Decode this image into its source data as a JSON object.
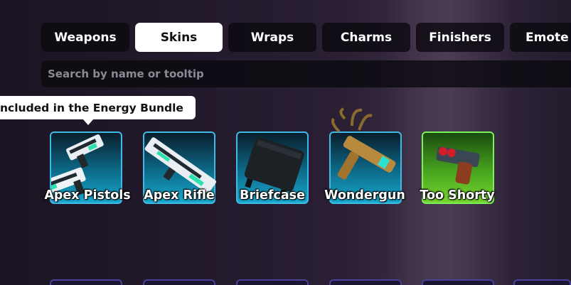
{
  "tabs": [
    {
      "label": "Weapons",
      "active": false
    },
    {
      "label": "Skins",
      "active": true
    },
    {
      "label": "Wraps",
      "active": false
    },
    {
      "label": "Charms",
      "active": false
    },
    {
      "label": "Finishers",
      "active": false
    },
    {
      "label": "Emote",
      "active": false
    }
  ],
  "search": {
    "placeholder": "Search by name or tooltip",
    "value": ""
  },
  "tooltip": {
    "text": "ncluded in the Energy Bundle"
  },
  "items": [
    {
      "name": "Apex Pistols",
      "rarity_color": "#3fb9e6",
      "icon": "apex-pistols-icon"
    },
    {
      "name": "Apex Rifle",
      "rarity_color": "#3fb9e6",
      "icon": "apex-rifle-icon"
    },
    {
      "name": "Briefcase",
      "rarity_color": "#3fb9e6",
      "icon": "briefcase-icon"
    },
    {
      "name": "Wondergun",
      "rarity_color": "#3fb9e6",
      "icon": "wondergun-icon"
    },
    {
      "name": "Too Shorty",
      "rarity_color": "#7bf255",
      "icon": "too-shorty-icon"
    }
  ]
}
